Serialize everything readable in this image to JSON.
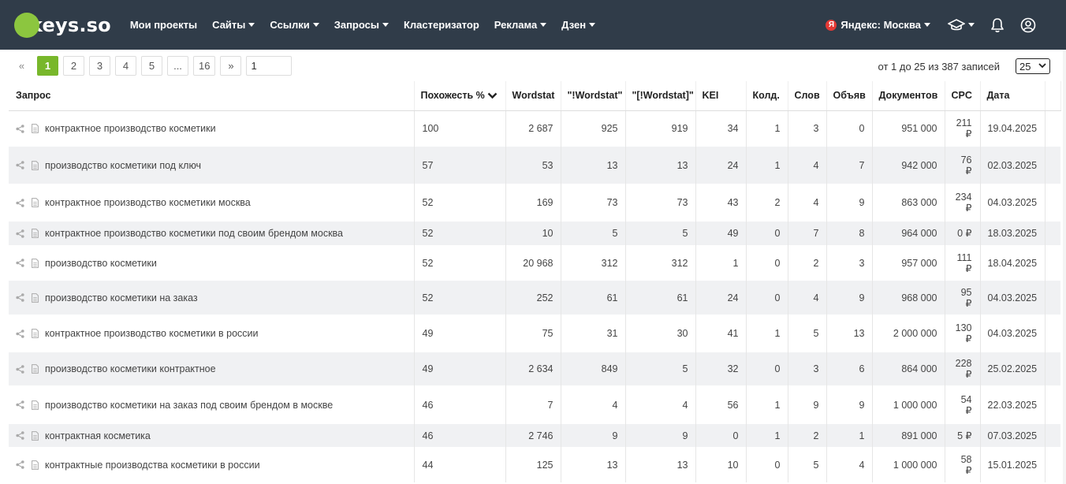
{
  "header": {
    "logo_text": "keys.so",
    "nav": [
      {
        "label": "Мои проекты",
        "dropdown": false
      },
      {
        "label": "Сайты",
        "dropdown": true
      },
      {
        "label": "Ссылки",
        "dropdown": true
      },
      {
        "label": "Запросы",
        "dropdown": true
      },
      {
        "label": "Кластеризатор",
        "dropdown": false
      },
      {
        "label": "Реклама",
        "dropdown": true
      },
      {
        "label": "Дзен",
        "dropdown": true
      }
    ],
    "region_badge": "Я",
    "region_label": "Яндекс: Москва",
    "icons": [
      "graduation-cap-icon",
      "bell-icon",
      "user-icon"
    ]
  },
  "pagination": {
    "prev": "«",
    "pages": [
      "1",
      "2",
      "3",
      "4",
      "5",
      "...",
      "16"
    ],
    "active": "1",
    "next": "»",
    "page_input_value": "1",
    "records_text": "от 1 до 25 из 387 записей",
    "per_page": "25"
  },
  "table": {
    "columns": [
      "Запрос",
      "Похожесть %",
      "Wordstat",
      "\"!Wordstat\"",
      "\"[!Wordstat]\"",
      "KEI",
      "Колд.",
      "Слов",
      "Объяв",
      "Документов",
      "CPC",
      "Дата"
    ],
    "sorted_column": "Похожесть %",
    "rows": [
      {
        "query": "контрактное производство косметики",
        "similarity": "100",
        "wordstat": "2 687",
        "ws_quoted": "925",
        "ws_exact": "919",
        "kei": "34",
        "cold": "1",
        "words": "3",
        "ads": "0",
        "docs": "951 000",
        "cpc": "211 ₽",
        "date": "19.04.2025"
      },
      {
        "query": "производство косметики под ключ",
        "similarity": "57",
        "wordstat": "53",
        "ws_quoted": "13",
        "ws_exact": "13",
        "kei": "24",
        "cold": "1",
        "words": "4",
        "ads": "7",
        "docs": "942 000",
        "cpc": "76 ₽",
        "date": "02.03.2025"
      },
      {
        "query": "контрактное производство косметики москва",
        "similarity": "52",
        "wordstat": "169",
        "ws_quoted": "73",
        "ws_exact": "73",
        "kei": "43",
        "cold": "2",
        "words": "4",
        "ads": "9",
        "docs": "863 000",
        "cpc": "234 ₽",
        "date": "04.03.2025"
      },
      {
        "query": "контрактное производство косметики под своим брендом москва",
        "similarity": "52",
        "wordstat": "10",
        "ws_quoted": "5",
        "ws_exact": "5",
        "kei": "49",
        "cold": "0",
        "words": "7",
        "ads": "8",
        "docs": "964 000",
        "cpc": "0 ₽",
        "date": "18.03.2025"
      },
      {
        "query": "производство косметики",
        "similarity": "52",
        "wordstat": "20 968",
        "ws_quoted": "312",
        "ws_exact": "312",
        "kei": "1",
        "cold": "0",
        "words": "2",
        "ads": "3",
        "docs": "957 000",
        "cpc": "111 ₽",
        "date": "18.04.2025"
      },
      {
        "query": "производство косметики на заказ",
        "similarity": "52",
        "wordstat": "252",
        "ws_quoted": "61",
        "ws_exact": "61",
        "kei": "24",
        "cold": "0",
        "words": "4",
        "ads": "9",
        "docs": "968 000",
        "cpc": "95 ₽",
        "date": "04.03.2025"
      },
      {
        "query": "контрактное производство косметики в россии",
        "similarity": "49",
        "wordstat": "75",
        "ws_quoted": "31",
        "ws_exact": "30",
        "kei": "41",
        "cold": "1",
        "words": "5",
        "ads": "13",
        "docs": "2 000 000",
        "cpc": "130 ₽",
        "date": "04.03.2025"
      },
      {
        "query": "производство косметики контрактное",
        "similarity": "49",
        "wordstat": "2 634",
        "ws_quoted": "849",
        "ws_exact": "5",
        "kei": "32",
        "cold": "0",
        "words": "3",
        "ads": "6",
        "docs": "864 000",
        "cpc": "228 ₽",
        "date": "25.02.2025"
      },
      {
        "query": "производство косметики на заказ под своим брендом в москве",
        "similarity": "46",
        "wordstat": "7",
        "ws_quoted": "4",
        "ws_exact": "4",
        "kei": "56",
        "cold": "1",
        "words": "9",
        "ads": "9",
        "docs": "1 000 000",
        "cpc": "54 ₽",
        "date": "22.03.2025"
      },
      {
        "query": "контрактная косметика",
        "similarity": "46",
        "wordstat": "2 746",
        "ws_quoted": "9",
        "ws_exact": "9",
        "kei": "0",
        "cold": "1",
        "words": "2",
        "ads": "1",
        "docs": "891 000",
        "cpc": "5 ₽",
        "date": "07.03.2025"
      },
      {
        "query": "контрактные производства косметики в россии",
        "similarity": "44",
        "wordstat": "125",
        "ws_quoted": "13",
        "ws_exact": "13",
        "kei": "10",
        "cold": "0",
        "words": "5",
        "ads": "4",
        "docs": "1 000 000",
        "cpc": "58 ₽",
        "date": "15.01.2025"
      }
    ]
  },
  "colors": {
    "header_bg": "#303c49",
    "accent_green": "#78b72b",
    "logo_green": "#8cc63f",
    "row_alt": "#f0f1f3",
    "yandex_red": "#e53935"
  }
}
